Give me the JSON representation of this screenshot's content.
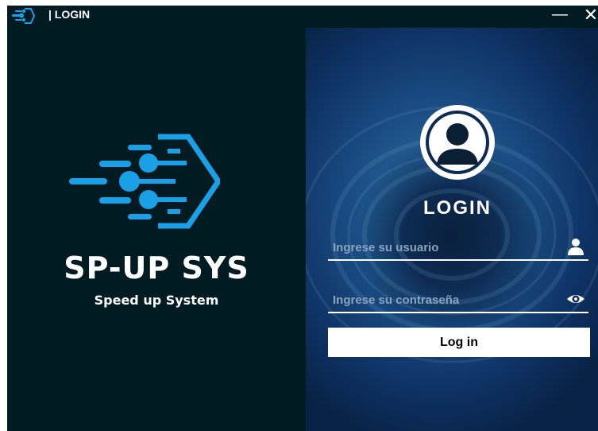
{
  "window": {
    "title": "| LOGIN",
    "app_icon": "app-logo-icon",
    "minimize_label": "—",
    "close_label": "✕"
  },
  "brand": {
    "name": "SP-UP SYS",
    "tagline": "Speed up System",
    "logo_color": "#1aa0e6"
  },
  "login": {
    "title": "LOGIN",
    "avatar_icon": "user-avatar-icon",
    "username": {
      "placeholder": "Ingrese su usuario",
      "value": "",
      "icon": "user-icon"
    },
    "password": {
      "placeholder": "Ingrese su contraseña",
      "value": "",
      "icon": "eye-icon"
    },
    "button_label": "Log in"
  },
  "colors": {
    "background_dark": "#011b23",
    "accent": "#1aa0e6",
    "text": "#ffffff"
  }
}
